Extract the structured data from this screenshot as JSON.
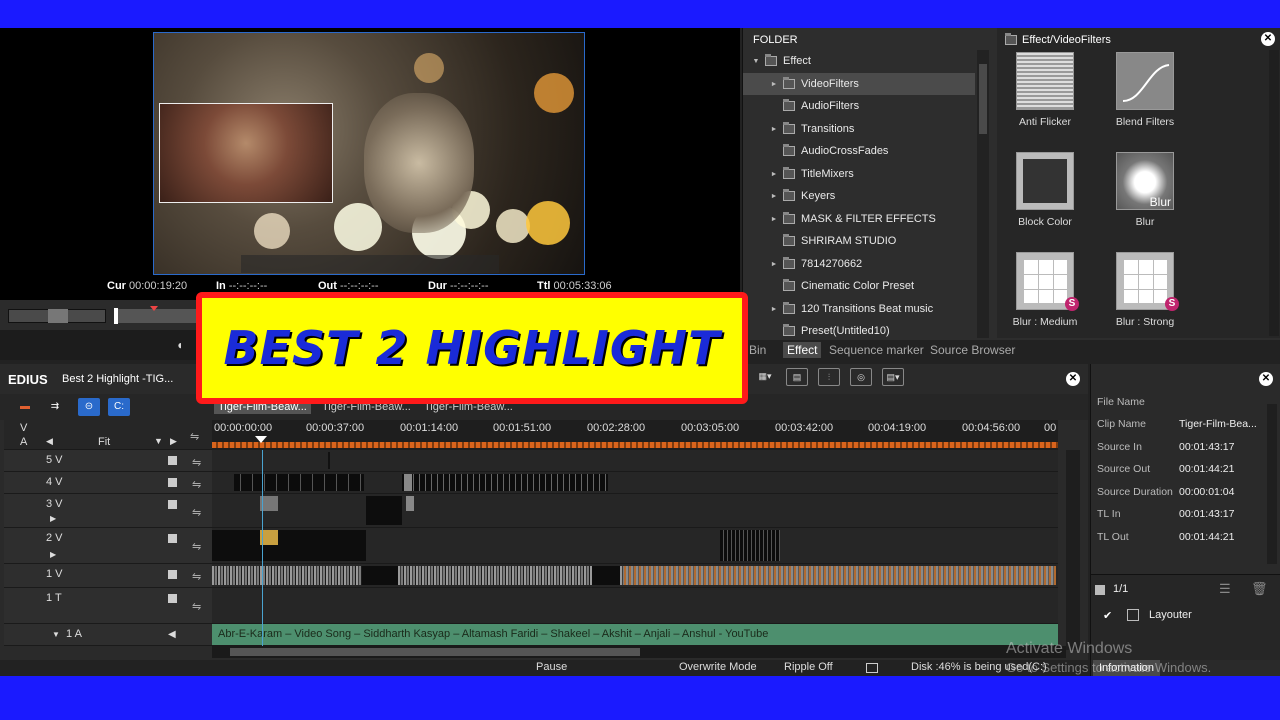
{
  "preview": {
    "timecodes": {
      "cur_label": "Cur",
      "cur_value": "00:00:19:20",
      "in_label": "In",
      "in_value": "--:--:--:--",
      "out_label": "Out",
      "out_value": "--:--:--:--",
      "dur_label": "Dur",
      "dur_value": "--:--:--:--",
      "ttl_label": "Ttl",
      "ttl_value": "00:05:33:06"
    }
  },
  "banner": {
    "text": "BEST 2 HIGHLIGHT"
  },
  "effects": {
    "folder_header": "FOLDER",
    "tree": [
      {
        "label": "Effect",
        "arrow": "▼"
      },
      {
        "label": "VideoFilters",
        "arrow": "►"
      },
      {
        "label": "AudioFilters",
        "arrow": ""
      },
      {
        "label": "Transitions",
        "arrow": "►"
      },
      {
        "label": "AudioCrossFades",
        "arrow": ""
      },
      {
        "label": "TitleMixers",
        "arrow": "►"
      },
      {
        "label": "Keyers",
        "arrow": "►"
      },
      {
        "label": "MASK & FILTER EFFECTS",
        "arrow": "►"
      },
      {
        "label": "SHRIRAM STUDIO",
        "arrow": ""
      },
      {
        "label": "7814270662",
        "arrow": "►"
      },
      {
        "label": "Cinematic Color Preset",
        "arrow": ""
      },
      {
        "label": "120 Transitions Beat music",
        "arrow": "►"
      },
      {
        "label": "Preset(Untitled10)",
        "arrow": ""
      }
    ],
    "effect_header": "Effect/VideoFilters",
    "items": [
      {
        "label": "Anti Flicker"
      },
      {
        "label": "Blend Filters"
      },
      {
        "label": "Block Color"
      },
      {
        "label": "Blur",
        "thumb_text": "Blur"
      },
      {
        "label": "Blur : Medium",
        "badge": "S"
      },
      {
        "label": "Blur : Strong",
        "badge": "S"
      }
    ],
    "tabs": [
      "Bin",
      "Effect",
      "Sequence marker",
      "Source Browser"
    ]
  },
  "timeline": {
    "app_name": "EDIUS",
    "project_title": "Best 2 Highlight -TIG...",
    "sequence_tabs": [
      "Tiger-Film-Beaw...",
      "Tiger-Film-Beaw...",
      "Tiger-Film-Beaw..."
    ],
    "v_label": "V",
    "a_label": "A",
    "fit_label": "Fit",
    "ruler": [
      "00:00:00:00",
      "00:00:37:00",
      "00:01:14:00",
      "00:01:51:00",
      "00:02:28:00",
      "00:03:05:00",
      "00:03:42:00",
      "00:04:19:00",
      "00:04:56:00",
      "00"
    ],
    "tracks": [
      "5 V",
      "4 V",
      "3 V",
      "2 V",
      "1 V",
      "1 T",
      "1 A"
    ],
    "audio_clip_text": "Abr-E-Karam – Video Song – Siddharth Kasyap – Altamash Faridi – Shakeel – Akshit – Anjali – Anshul - YouTube",
    "status": {
      "state": "Pause",
      "mode": "Overwrite Mode",
      "ripple": "Ripple Off",
      "disk": "Disk :46% is being used(C:)"
    }
  },
  "info": {
    "rows": [
      {
        "key": "File Name",
        "value": ""
      },
      {
        "key": "Clip Name",
        "value": "Tiger-Film-Bea..."
      },
      {
        "key": "Source In",
        "value": "00:01:43:17"
      },
      {
        "key": "Source Out",
        "value": "00:01:44:21"
      },
      {
        "key": "Source Duration",
        "value": "00:00:01:04"
      },
      {
        "key": "TL In",
        "value": "00:01:43:17"
      },
      {
        "key": "TL Out",
        "value": "00:01:44:21"
      }
    ],
    "page": "1/1",
    "layouter": "Layouter",
    "tab": "Information"
  },
  "watermark": {
    "line1": "Activate Windows",
    "line2": "Go to Settings to activate Windows."
  },
  "colors": {
    "accent": "#2a6acb",
    "banner_bg": "#ffff00",
    "banner_border": "#ff1a1a",
    "banner_text": "#1a2bd8",
    "ruler": "#d9641c",
    "audio_clip": "#4d8f6e"
  }
}
